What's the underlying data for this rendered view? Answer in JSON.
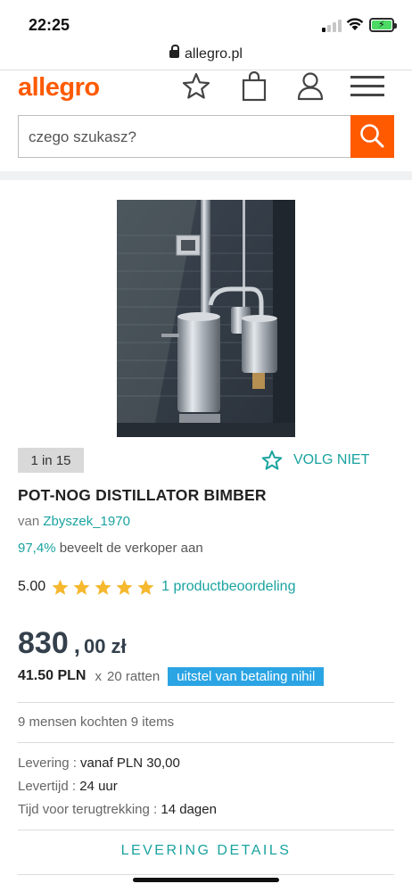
{
  "status_bar": {
    "time": "22:25"
  },
  "browser": {
    "url": "allegro.pl"
  },
  "header": {
    "logo": "allegro",
    "search_placeholder": "czego szukasz?"
  },
  "product": {
    "image_counter": "1 in 15",
    "follow_label": "VOLG NIET",
    "title": "POT-NOG DISTILLATOR BIMBER",
    "seller_prefix": "van",
    "seller_name": "Zbyszek_1970",
    "recommend_pct": "97,4%",
    "recommend_text": "beveelt de verkoper aan",
    "rating_score": "5.00",
    "rating_stars": 5,
    "reviews_text": "1 productbeoordeling"
  },
  "price": {
    "integer": "830",
    "separator": ",",
    "decimals": "00 zł",
    "installment_amount": "41.50 PLN",
    "installment_x": "x",
    "installment_count": "20 ratten",
    "installment_tag": "uitstel van betaling nihil"
  },
  "sales": {
    "text": "9 mensen kochten 9 items"
  },
  "delivery": {
    "rows": [
      {
        "label": "Levering :",
        "value": "vanaf PLN 30,00"
      },
      {
        "label": "Levertijd :",
        "value": "24 uur"
      },
      {
        "label": "Tijd voor terugtrekking :",
        "value": "14 dagen"
      }
    ],
    "details_button": "LEVERING DETAILS"
  },
  "colors": {
    "brand": "#ff5a00",
    "link": "#1aa3a0",
    "price": "#34404c",
    "tag": "#2ba4e4",
    "star": "#f5b82e"
  }
}
